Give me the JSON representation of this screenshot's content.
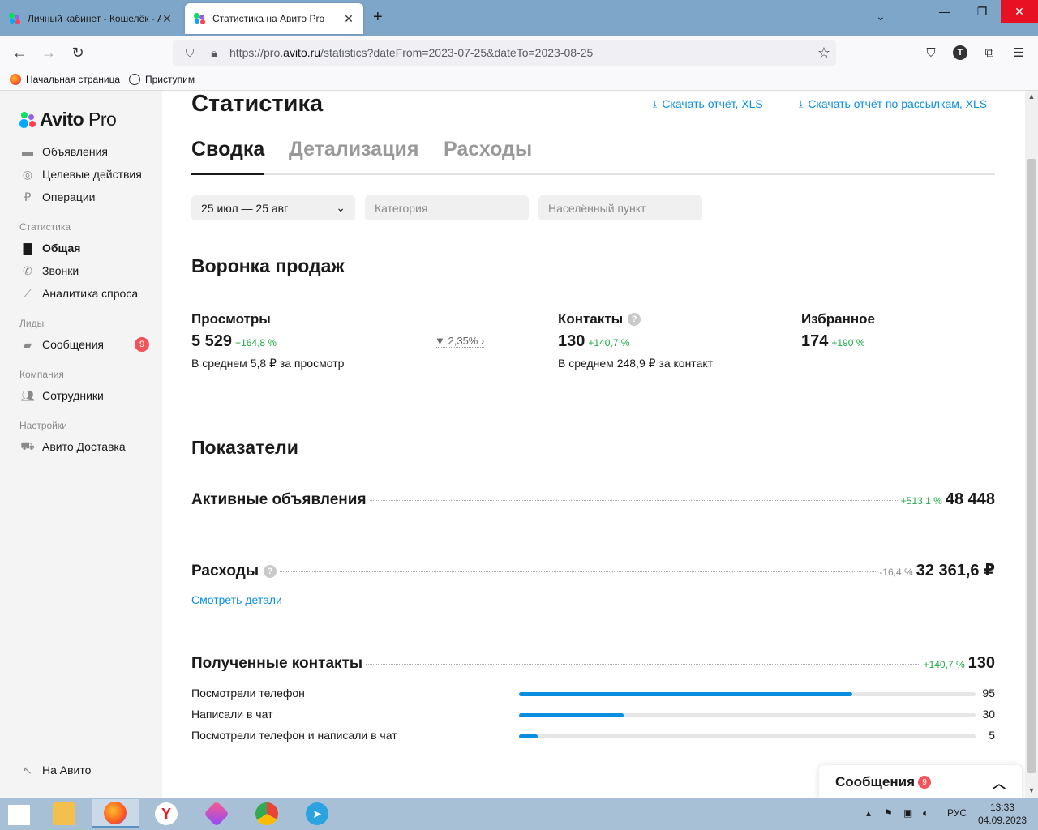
{
  "browser": {
    "tabs": [
      {
        "title": "Личный кабинет - Кошелёк - А"
      },
      {
        "title": "Статистика на Авито Pro"
      }
    ],
    "url_prefix": "https://pro.",
    "url_host": "avito.ru",
    "url_path": "/statistics?dateFrom=2023-07-25&dateTo=2023-08-25",
    "profile_initial": "T",
    "bookmarks": [
      "Начальная страница",
      "Приступим"
    ]
  },
  "sidebar": {
    "logo_avito": "Avito",
    "logo_pro": " Pro",
    "items": [
      {
        "label": "Объявления",
        "icon": "ads-icon"
      },
      {
        "label": "Целевые действия",
        "icon": "target-icon"
      },
      {
        "label": "Операции",
        "icon": "operations-icon"
      }
    ],
    "stats_head": "Статистика",
    "stats_items": [
      {
        "label": "Общая",
        "icon": "bar-chart-icon"
      },
      {
        "label": "Звонки",
        "icon": "phone-icon"
      },
      {
        "label": "Аналитика спроса",
        "icon": "trend-icon"
      }
    ],
    "leads_head": "Лиды",
    "messages_label": "Сообщения",
    "messages_badge": "9",
    "company_head": "Компания",
    "staff_label": "Сотрудники",
    "settings_head": "Настройки",
    "delivery_label": "Авито Доставка",
    "back_label": "На Авито"
  },
  "main": {
    "title": "Статистика",
    "download_xls": "Скачать отчёт, XLS",
    "download_mail_xls": "Скачать отчёт по рассылкам, XLS",
    "tabs": [
      "Сводка",
      "Детализация",
      "Расходы"
    ],
    "filters": {
      "period": "25 июл — 25 авг",
      "category": "Категория",
      "location": "Населённый пункт"
    },
    "funnel": {
      "title": "Воронка продаж",
      "views": {
        "label": "Просмотры",
        "value": "5 529",
        "delta": "+164,8 %",
        "sub": "В среднем 5,8 ₽ за просмотр"
      },
      "conversion": "2,35%",
      "contacts": {
        "label": "Контакты",
        "value": "130",
        "delta": "+140,7 %",
        "sub": "В среднем 248,9 ₽ за контакт"
      },
      "favorites": {
        "label": "Избранное",
        "value": "174",
        "delta": "+190 %"
      }
    },
    "indicators": {
      "title": "Показатели",
      "active_ads": {
        "label": "Активные объявления",
        "delta": "+513,1 %",
        "value": "48 448"
      },
      "expenses": {
        "label": "Расходы",
        "delta": "-16,4 %",
        "value": "32 361,6 ₽"
      },
      "details_link": "Смотреть детали",
      "contacts": {
        "label": "Полученные контакты",
        "delta": "+140,7 %",
        "value": "130"
      },
      "breakdown": [
        {
          "label": "Посмотрели телефон",
          "value": "95",
          "fraction": 0.73
        },
        {
          "label": "Написали в чат",
          "value": "30",
          "fraction": 0.23
        },
        {
          "label": "Посмотрели телефон и написали в чат",
          "value": "5",
          "fraction": 0.04
        }
      ]
    }
  },
  "messages_widget": {
    "label": "Сообщения",
    "badge": "9"
  },
  "taskbar": {
    "lang": "РУС",
    "time": "13:33",
    "date": "04.09.2023"
  },
  "colors": {
    "accent": "#0a8ee0",
    "positive": "#1eaa47",
    "badge": "#f2545b"
  }
}
